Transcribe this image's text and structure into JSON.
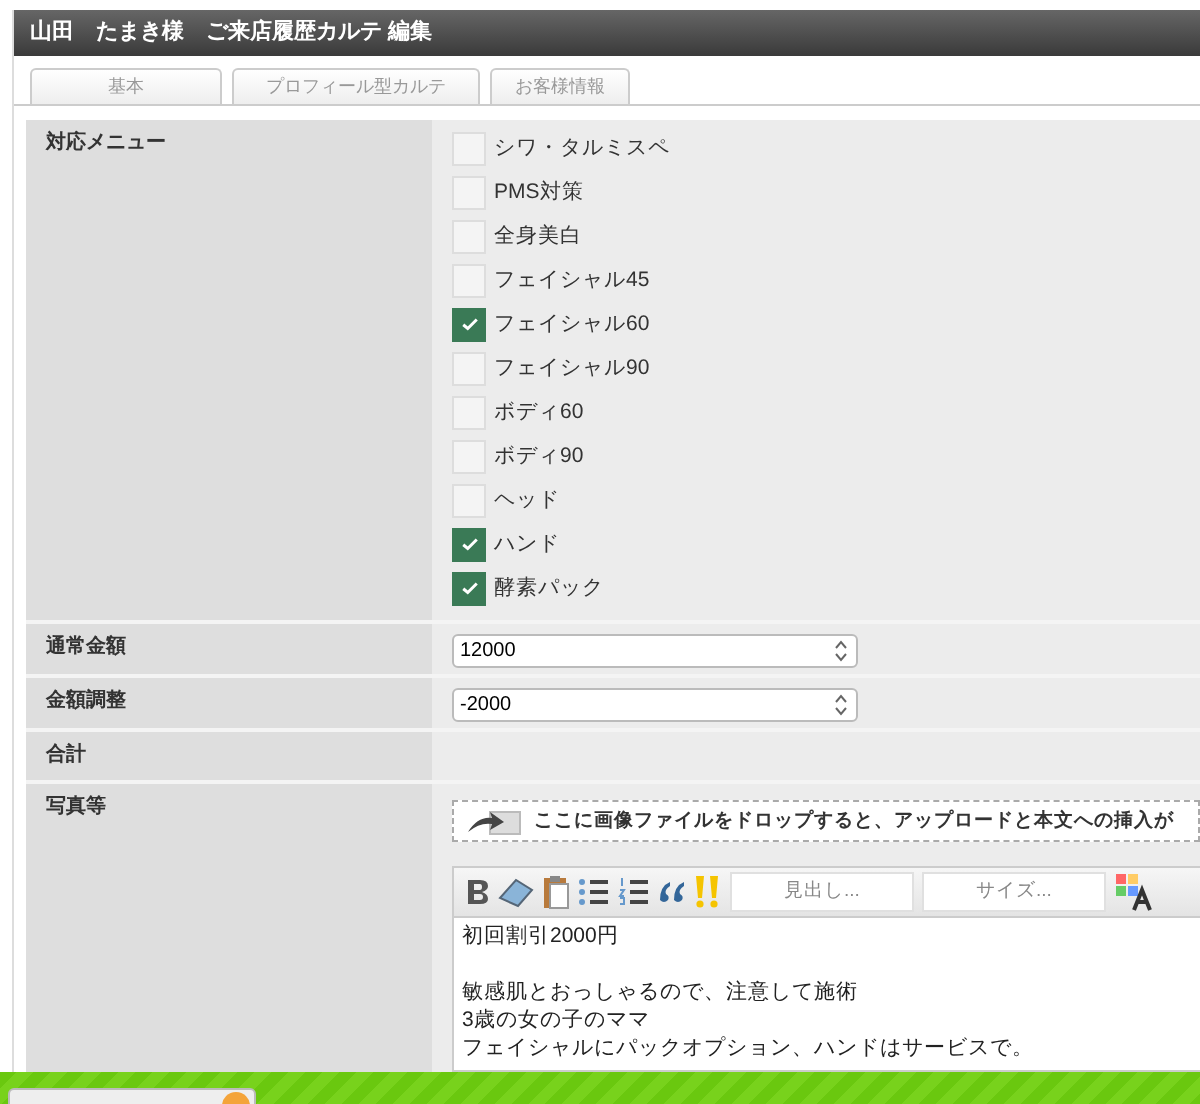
{
  "window": {
    "title": "山田　たまき様　ご来店履歴カルテ 編集"
  },
  "tabs": [
    {
      "label": "基本",
      "selected": false
    },
    {
      "label": "プロフィール型カルテ",
      "selected": false
    },
    {
      "label": "お客様情報",
      "selected": false
    }
  ],
  "menu_field": {
    "label": "対応メニュー",
    "options": [
      {
        "label": "シワ・タルミスペ",
        "checked": false
      },
      {
        "label": "PMS対策",
        "checked": false
      },
      {
        "label": "全身美白",
        "checked": false
      },
      {
        "label": "フェイシャル45",
        "checked": false
      },
      {
        "label": "フェイシャル60",
        "checked": true
      },
      {
        "label": "フェイシャル90",
        "checked": false
      },
      {
        "label": "ボディ60",
        "checked": false
      },
      {
        "label": "ボディ90",
        "checked": false
      },
      {
        "label": "ヘッド",
        "checked": false
      },
      {
        "label": "ハンド",
        "checked": true
      },
      {
        "label": "酵素パック",
        "checked": true
      }
    ]
  },
  "number_fields": [
    {
      "label": "通常金額",
      "value": "12000"
    },
    {
      "label": "金額調整",
      "value": "-2000"
    }
  ],
  "total": {
    "label": "合計"
  },
  "photos": {
    "label": "写真等",
    "drop_hint": "ここに画像ファイルをドロップすると、アップロードと本文への挿入が",
    "heading_select": "見出し...",
    "size_select": "サイズ...",
    "body_paragraphs": [
      [
        "初回割引2000円"
      ],
      [
        "敏感肌とおっしゃるので、注意して施術",
        "3歳の女の子のママ",
        "フェイシャルにパックオプション、ハンドはサービスで。"
      ]
    ]
  }
}
